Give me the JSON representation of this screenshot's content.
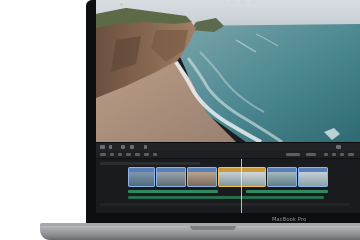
{
  "device": {
    "model_label": "MacBook Pro"
  },
  "viewer": {
    "timecode": "1:00:00:00",
    "scene": "aerial-coastline-cliffs-beach-waves"
  },
  "timeline": {
    "header_label": "",
    "clips": [
      {
        "name": "clip-1",
        "selected": false
      },
      {
        "name": "clip-2",
        "selected": false
      },
      {
        "name": "clip-3",
        "selected": false
      },
      {
        "name": "clip-4",
        "selected": true
      },
      {
        "name": "clip-5",
        "selected": false
      },
      {
        "name": "clip-6",
        "selected": false
      }
    ]
  },
  "colors": {
    "clip_border": "#8fb4ea",
    "clip_selected_border": "#f2c14e",
    "audio_track": "#2f8a5e",
    "ui_dark": "#1b1c1f"
  }
}
